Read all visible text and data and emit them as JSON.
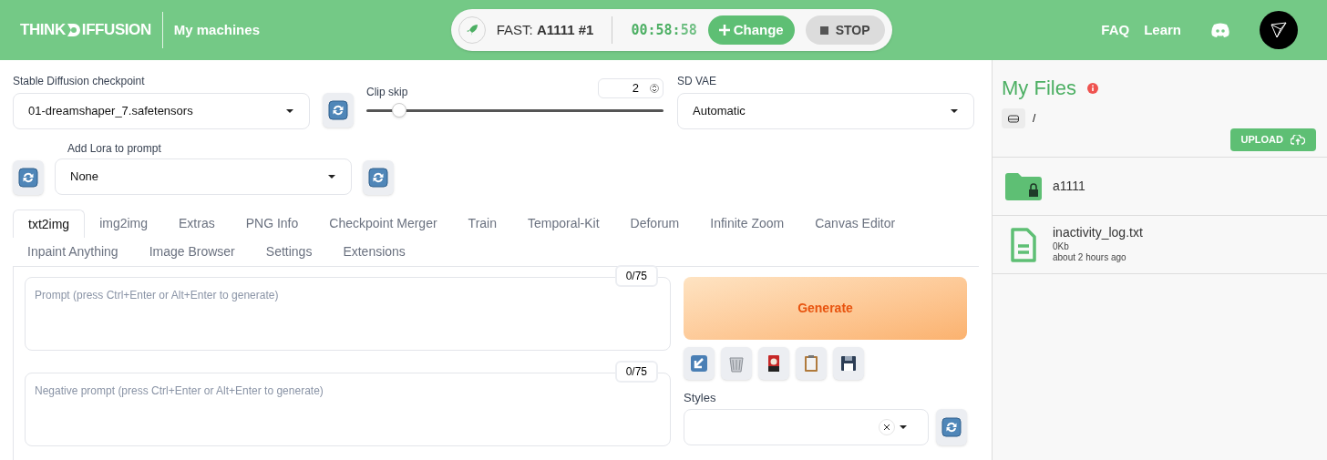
{
  "header": {
    "logo_left": "THINK",
    "logo_right": "IFFUSION",
    "machines_link": "My machines",
    "machine": "FAST: **A1111 #1**",
    "timer_main": "00:58:",
    "timer_dim": "58",
    "change_button": "Change",
    "stop_button": "STOP",
    "links": [
      "FAQ",
      "Learn"
    ]
  },
  "settings": {
    "checkpoint": {
      "label": "Stable Diffusion checkpoint",
      "value": "01-dreamshaper_7.safetensors"
    },
    "clip_skip": {
      "label": "Clip skip",
      "value": "2",
      "level": 0.11
    },
    "vae": {
      "label": "SD VAE",
      "value": "Automatic"
    },
    "lora": {
      "label": "Add Lora to prompt",
      "value": "None"
    }
  },
  "tabs": [
    {
      "label": "txt2img",
      "selected": true
    },
    {
      "label": "img2img",
      "selected": false
    },
    {
      "label": "Extras",
      "selected": false
    },
    {
      "label": "PNG Info",
      "selected": false
    },
    {
      "label": "Checkpoint Merger",
      "selected": false
    },
    {
      "label": "Train",
      "selected": false
    },
    {
      "label": "Temporal-Kit",
      "selected": false
    },
    {
      "label": "Deforum",
      "selected": false
    },
    {
      "label": "Infinite Zoom",
      "selected": false
    },
    {
      "label": "Canvas Editor",
      "selected": false
    },
    {
      "label": "Inpaint Anything",
      "selected": false
    },
    {
      "label": "Image Browser",
      "selected": false
    },
    {
      "label": "Settings",
      "selected": false
    },
    {
      "label": "Extensions",
      "selected": false
    }
  ],
  "prompt": {
    "placeholder": "Prompt (press Ctrl+Enter or Alt+Enter to generate)",
    "counter": "0/75"
  },
  "negative_prompt": {
    "placeholder": "Negative prompt (press Ctrl+Enter or Alt+Enter to generate)",
    "counter": "0/75"
  },
  "generate_button": "Generate",
  "tools": [
    {
      "kind": "arrow"
    },
    {
      "kind": "trash"
    },
    {
      "kind": "card"
    },
    {
      "kind": "clipboard"
    },
    {
      "kind": "save"
    }
  ],
  "styles": {
    "label": "Styles"
  },
  "files": {
    "title": "My Files",
    "path": "/",
    "upload_button": "UPLOAD",
    "items": [
      {
        "kind": "folder",
        "name": "a1111"
      },
      {
        "kind": "file",
        "name": "inactivity_log.txt",
        "size": "0Kb",
        "modified": "about 2 hours ago"
      }
    ]
  }
}
